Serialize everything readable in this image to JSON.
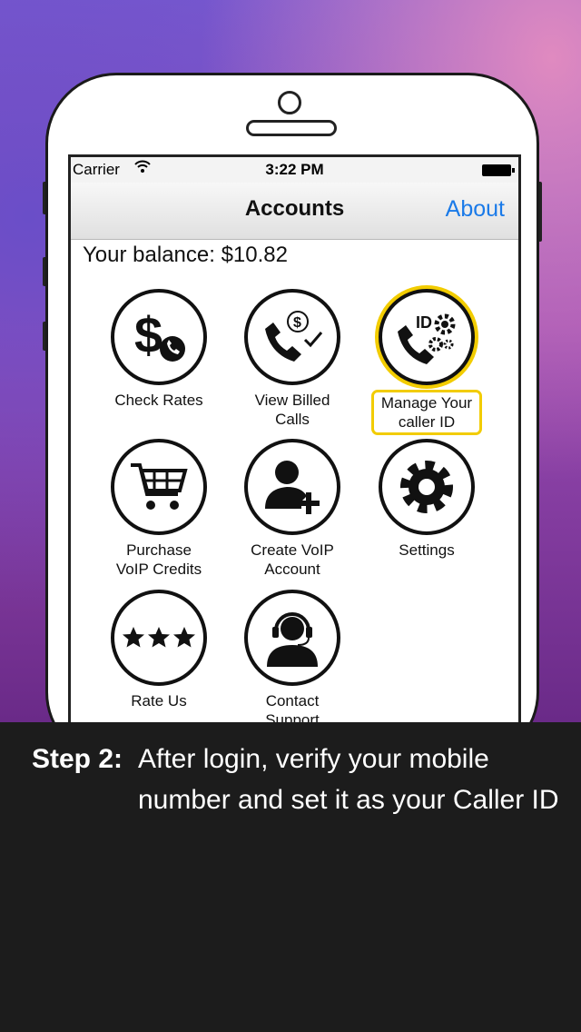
{
  "status": {
    "carrier": "Carrier",
    "time": "3:22 PM"
  },
  "nav": {
    "title": "Accounts",
    "about": "About"
  },
  "balance": "Your balance: $10.82",
  "tiles": [
    {
      "label1": "Check Rates",
      "label2": "",
      "icon": "dollar-phone-icon"
    },
    {
      "label1": "View Billed",
      "label2": "Calls",
      "icon": "billed-calls-icon"
    },
    {
      "label1": "Manage Your",
      "label2": "caller ID",
      "icon": "caller-id-gear-icon"
    },
    {
      "label1": "Purchase",
      "label2": "VoIP Credits",
      "icon": "cart-icon"
    },
    {
      "label1": "Create VoIP",
      "label2": "Account",
      "icon": "add-user-icon"
    },
    {
      "label1": "Settings",
      "label2": "",
      "icon": "gear-icon"
    },
    {
      "label1": "Rate Us",
      "label2": "",
      "icon": "stars-icon"
    },
    {
      "label1": "Contact",
      "label2": "Support",
      "icon": "headset-icon"
    }
  ],
  "caption": {
    "step": "Step 2:",
    "text": "After login, verify your mobile number and set it as your Caller ID"
  },
  "colors": {
    "highlight": "#f2cc00",
    "link": "#1a7ae8"
  }
}
